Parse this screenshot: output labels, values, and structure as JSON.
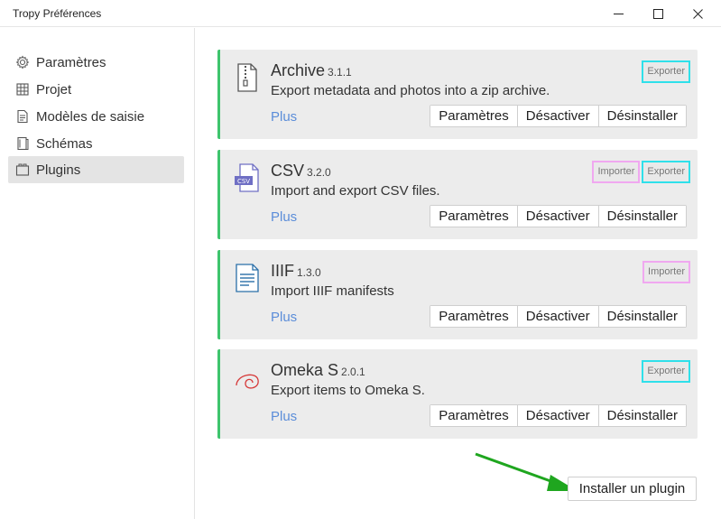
{
  "window": {
    "title": "Tropy Préférences",
    "min_icon": "minimize-icon",
    "max_icon": "maximize-icon",
    "close_icon": "close-icon"
  },
  "sidebar": {
    "items": [
      {
        "label": "Paramètres",
        "icon": "gear-icon",
        "active": false
      },
      {
        "label": "Projet",
        "icon": "project-icon",
        "active": false
      },
      {
        "label": "Modèles de saisie",
        "icon": "template-icon",
        "active": false
      },
      {
        "label": "Schémas",
        "icon": "schema-icon",
        "active": false
      },
      {
        "label": "Plugins",
        "icon": "plugin-icon",
        "active": true
      }
    ]
  },
  "plugins": [
    {
      "name": "Archive",
      "version": "3.1.1",
      "description": "Export metadata and photos into a zip archive.",
      "more": "Plus",
      "icon": "zip-file-icon",
      "tags": [
        "Exporter"
      ],
      "buttons": [
        "Paramètres",
        "Désactiver",
        "Désinstaller"
      ]
    },
    {
      "name": "CSV",
      "version": "3.2.0",
      "description": "Import and export CSV files.",
      "more": "Plus",
      "icon": "csv-file-icon",
      "tags": [
        "Importer",
        "Exporter"
      ],
      "buttons": [
        "Paramètres",
        "Désactiver",
        "Désinstaller"
      ]
    },
    {
      "name": "IIIF",
      "version": "1.3.0",
      "description": "Import IIIF manifests",
      "more": "Plus",
      "icon": "document-icon",
      "tags": [
        "Importer"
      ],
      "buttons": [
        "Paramètres",
        "Désactiver",
        "Désinstaller"
      ]
    },
    {
      "name": "Omeka S",
      "version": "2.0.1",
      "description": "Export items to Omeka S.",
      "more": "Plus",
      "icon": "omeka-swirl-icon",
      "tags": [
        "Exporter"
      ],
      "buttons": [
        "Paramètres",
        "Désactiver",
        "Désinstaller"
      ]
    }
  ],
  "install_button": "Installer un plugin",
  "colors": {
    "accent_green": "#3ec46d",
    "link_blue": "#5b8dd9",
    "export_tag_border": "#2fe0ea",
    "import_tag_border": "#f0a8f0",
    "annotation_arrow": "#1fa61f"
  }
}
